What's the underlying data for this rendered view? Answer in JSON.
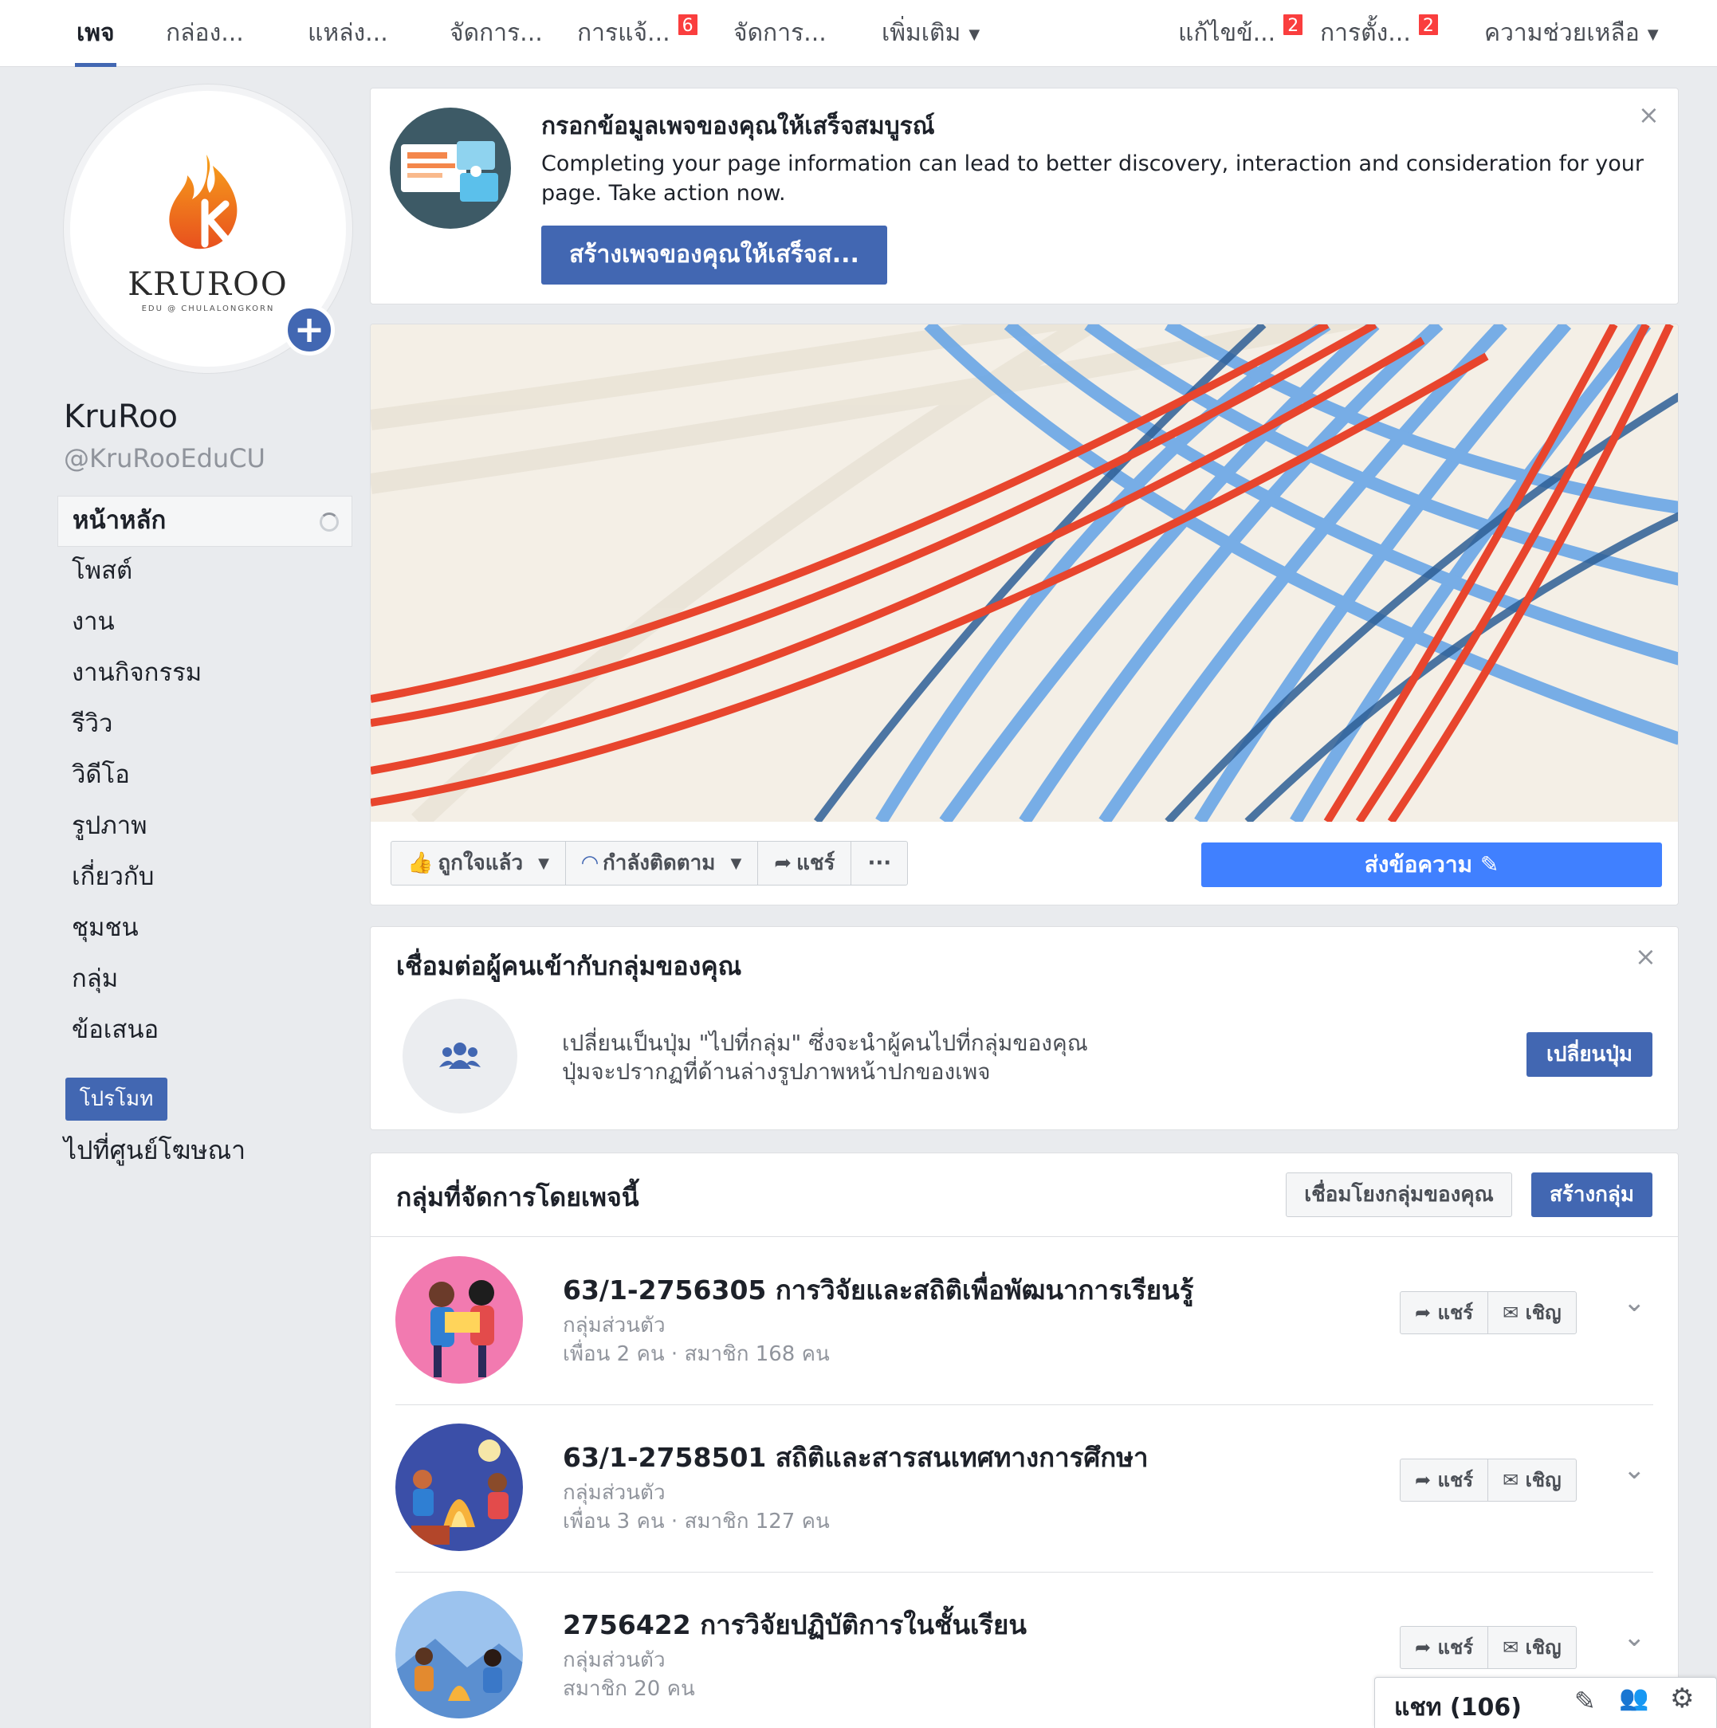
{
  "topnav": {
    "tabs": [
      {
        "label": "เพจ",
        "active": true
      },
      {
        "label": "กล่อง..."
      },
      {
        "label": "แหล่ง..."
      },
      {
        "label": "จัดการ..."
      },
      {
        "label": "การแจ้...",
        "badge": "6"
      },
      {
        "label": "จัดการ..."
      },
      {
        "label": "เพิ่มเติม"
      }
    ],
    "right": [
      {
        "label": "แก้ไขข้...",
        "badge": "2"
      },
      {
        "label": "การตั้ง...",
        "badge": "2"
      },
      {
        "label": "ความช่วยเหลือ"
      }
    ]
  },
  "profile": {
    "logo_text": "KRUROO",
    "logo_sub": "EDU @ CHULALONGKORN",
    "name": "KruRoo",
    "handle": "@KruRooEduCU"
  },
  "sidebar": {
    "items": [
      {
        "label": "หน้าหลัก",
        "active": true
      },
      {
        "label": "โพสต์"
      },
      {
        "label": "งาน"
      },
      {
        "label": "งานกิจกรรม"
      },
      {
        "label": "รีวิว"
      },
      {
        "label": "วิดีโอ"
      },
      {
        "label": "รูปภาพ"
      },
      {
        "label": "เกี่ยวกับ"
      },
      {
        "label": "ชุมชน"
      },
      {
        "label": "กลุ่ม"
      },
      {
        "label": "ข้อเสนอ"
      }
    ],
    "promote_label": "โปรโมท",
    "ads_link": "ไปที่ศูนย์โฆษณา"
  },
  "complete_card": {
    "title": "กรอกข้อมูลเพจของคุณให้เสร็จสมบูรณ์",
    "body": "Completing your page information can lead to better discovery, interaction and consideration for your page. Take action now.",
    "button": "สร้างเพจของคุณให้เสร็จส..."
  },
  "cover_actions": {
    "liked": "ถูกใจแล้ว",
    "following": "กำลังติดตาม",
    "share": "แชร์",
    "more": "···",
    "message": "ส่งข้อความ"
  },
  "connect_card": {
    "title": "เชื่อมต่อผู้คนเข้ากับกลุ่มของคุณ",
    "line1": "เปลี่ยนเป็นปุ่ม \"ไปที่กลุ่ม\" ซึ่งจะนำผู้คนไปที่กลุ่มของคุณ",
    "line2": "ปุ่มจะปรากฏที่ด้านล่างรูปภาพหน้าปกของเพจ",
    "button": "เปลี่ยนปุ่ม"
  },
  "groups_card": {
    "title": "กลุ่มที่จัดการโดยเพจนี้",
    "link_button": "เชื่อมโยงกลุ่มของคุณ",
    "create_button": "สร้างกลุ่ม",
    "share_label": "แชร์",
    "invite_label": "เชิญ",
    "groups": [
      {
        "title": "63/1-2756305 การวิจัยและสถิติเพื่อพัฒนาการเรียนรู้",
        "type": "กลุ่มส่วนตัว",
        "meta": "เพื่อน 2 คน · สมาชิก 168 คน"
      },
      {
        "title": "63/1-2758501 สถิติและสารสนเทศทางการศึกษา",
        "type": "กลุ่มส่วนตัว",
        "meta": "เพื่อน 3 คน · สมาชิก 127 คน"
      },
      {
        "title": "2756422 การวิจัยปฏิบัติการในชั้นเรียน",
        "type": "กลุ่มส่วนตัว",
        "meta": "สมาชิก 20 คน"
      }
    ]
  },
  "chat": {
    "label": "แชท (106)"
  },
  "colors": {
    "accent": "#4267b2",
    "message_btn": "#4080ff",
    "badge": "#fa3e3e"
  }
}
